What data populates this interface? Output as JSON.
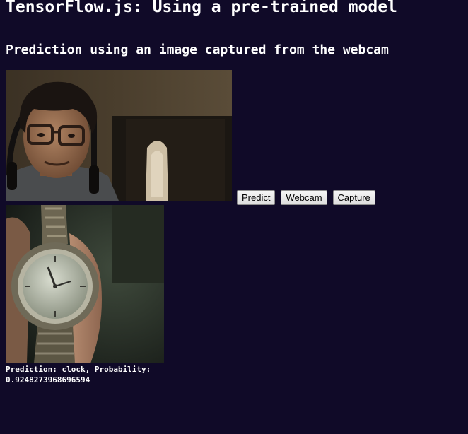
{
  "page": {
    "title": "TensorFlow.js: Using a pre-trained model",
    "subtitle": "Prediction using an image captured from the webcam"
  },
  "webcam_feed": {
    "icon": "webcam-video-person-face"
  },
  "captured_image": {
    "icon": "captured-photo-wristwatch"
  },
  "buttons": {
    "predict": "Predict",
    "webcam": "Webcam",
    "capture": "Capture"
  },
  "result": {
    "text": "Prediction: clock, Probability: 0.9248273968696594"
  },
  "colors": {
    "background": "#100a28",
    "text": "#ffffff"
  }
}
